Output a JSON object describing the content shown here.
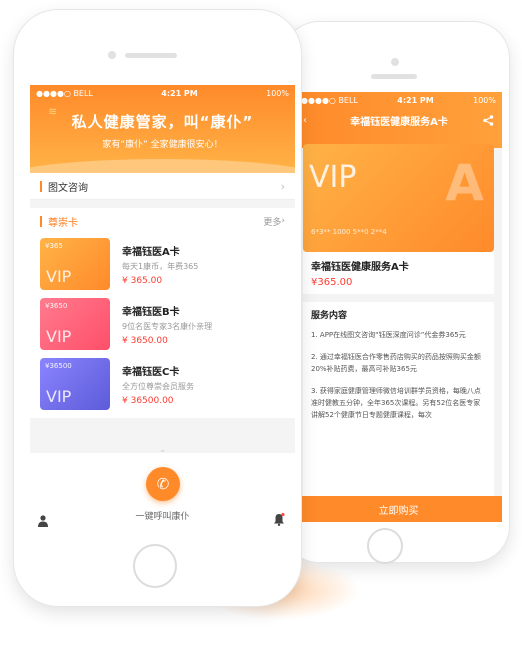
{
  "front": {
    "status": {
      "carrier": "●●●●○ BELL",
      "time": "4:21 PM",
      "battery": "100%"
    },
    "hero": {
      "title": "私人健康管家，叫“康仆”",
      "subtitle": "家有“康仆” 全家健康很安心！"
    },
    "consult": {
      "label": "图文咨询"
    },
    "membership": {
      "title": "尊崇卡",
      "more": "更多",
      "cards": [
        {
          "badge": "¥365",
          "vip": "VIP",
          "name": "幸福钰医A卡",
          "desc": "每天1康币，年费365",
          "price": "¥ 365.00",
          "color": "#ff9a33"
        },
        {
          "badge": "¥3650",
          "vip": "VIP",
          "name": "幸福钰医B卡",
          "desc": "9位名医专家3名康仆亲理",
          "price": "¥ 3650.00",
          "color": "#ff5c74"
        },
        {
          "badge": "¥36500",
          "vip": "VIP",
          "name": "幸福钰医C卡",
          "desc": "全方位尊崇会员服务",
          "price": "¥ 36500.00",
          "color": "#6d68e6"
        }
      ]
    },
    "call": {
      "label": "一键呼叫康仆",
      "icon": "phone-icon"
    }
  },
  "back": {
    "status": {
      "carrier": "●●●●○ BELL",
      "time": "4:21 PM",
      "battery": "100%"
    },
    "nav": {
      "title": "幸福钰医健康服务A卡",
      "share_icon": "share-icon"
    },
    "card": {
      "vip": "VIP",
      "number": "6*3** 1000 5**0 2**4"
    },
    "info": {
      "name": "幸福钰医健康服务A卡",
      "price": "¥365.00"
    },
    "service": {
      "heading": "服务内容",
      "items": [
        "1. APP在线图文咨询“钰医深度问诊”代金券365元",
        "2. 通过幸福钰医合作零售药店购买的药品按照购买金额20%补贴药费，最高可补贴365元",
        "3. 获得家庭健康管理师微信培训群学员资格，每晚八点准时健教五分钟，全年365次课程。另有52位名医专家讲解52个健康节日专题健康课程，每次"
      ]
    },
    "buy": {
      "label": "立即购买"
    }
  }
}
